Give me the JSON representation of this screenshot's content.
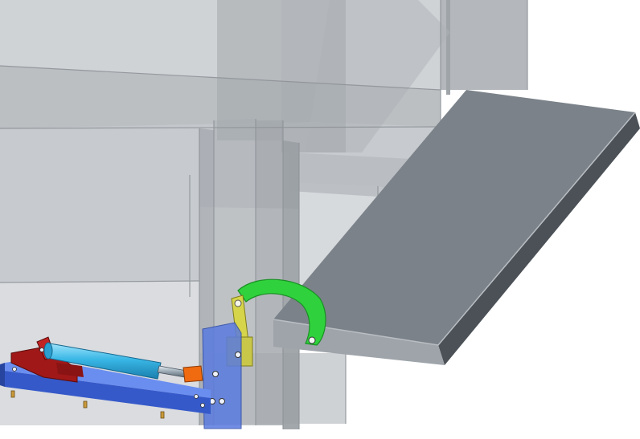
{
  "scene": {
    "type": "cad-3d-render",
    "description_visible_text": "",
    "colors": {
      "background": "#ffffff",
      "housing_glass": "#c9ccd0",
      "housing_edge": "#9a9ea3",
      "platform_top": "#7d848b",
      "platform_side": "#4d5359",
      "hydraulic_cylinder": "#39b7e6",
      "base_rail": "#3f6cdb",
      "mount_red": "#a01818",
      "bracket_yellow": "#d6d44a",
      "arc_link_green": "#2fd23c",
      "connector_orange": "#f06a10",
      "pivot_block_blue": "#5a7be0"
    },
    "parts": [
      {
        "name": "translucent-housing"
      },
      {
        "name": "grey-platform"
      },
      {
        "name": "hydraulic-cylinder"
      },
      {
        "name": "blue-base-rail"
      },
      {
        "name": "red-mount"
      },
      {
        "name": "yellow-link-bracket"
      },
      {
        "name": "green-arc-link"
      },
      {
        "name": "orange-connector"
      },
      {
        "name": "blue-pivot-block"
      }
    ]
  }
}
